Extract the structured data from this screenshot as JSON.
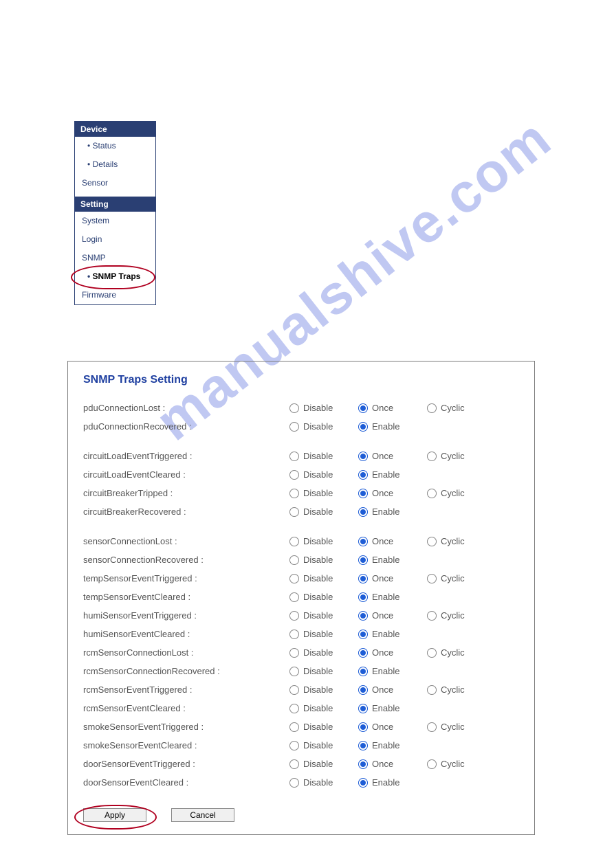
{
  "watermark": "manualshive.com",
  "nav": {
    "sections": [
      {
        "header": "Device",
        "items": [
          {
            "label": "Status",
            "sub": true
          },
          {
            "label": "Details",
            "sub": true
          },
          {
            "label": "Sensor",
            "sub": false
          }
        ]
      },
      {
        "header": "Setting",
        "items": [
          {
            "label": "System",
            "sub": false
          },
          {
            "label": "Login",
            "sub": false
          },
          {
            "label": "SNMP",
            "sub": false
          },
          {
            "label": "SNMP Traps",
            "sub": true,
            "selected": true,
            "circled": true
          },
          {
            "label": "Firmware",
            "sub": false
          }
        ]
      }
    ]
  },
  "panel": {
    "title": "SNMP Traps Setting",
    "option_labels": {
      "disable": "Disable",
      "once": "Once",
      "cyclic": "Cyclic",
      "enable": "Enable"
    },
    "groups": [
      [
        {
          "name": "pduConnectionLost :",
          "type": "tri",
          "selected": "once"
        },
        {
          "name": "pduConnectionRecovered :",
          "type": "bi",
          "selected": "enable"
        }
      ],
      [
        {
          "name": "circuitLoadEventTriggered :",
          "type": "tri",
          "selected": "once"
        },
        {
          "name": "circuitLoadEventCleared :",
          "type": "bi",
          "selected": "enable"
        },
        {
          "name": "circuitBreakerTripped :",
          "type": "tri",
          "selected": "once"
        },
        {
          "name": "circuitBreakerRecovered :",
          "type": "bi",
          "selected": "enable"
        }
      ],
      [
        {
          "name": "sensorConnectionLost :",
          "type": "tri",
          "selected": "once"
        },
        {
          "name": "sensorConnectionRecovered :",
          "type": "bi",
          "selected": "enable"
        },
        {
          "name": "tempSensorEventTriggered :",
          "type": "tri",
          "selected": "once"
        },
        {
          "name": "tempSensorEventCleared :",
          "type": "bi",
          "selected": "enable"
        },
        {
          "name": "humiSensorEventTriggered :",
          "type": "tri",
          "selected": "once"
        },
        {
          "name": "humiSensorEventCleared :",
          "type": "bi",
          "selected": "enable"
        },
        {
          "name": "rcmSensorConnectionLost :",
          "type": "tri",
          "selected": "once"
        },
        {
          "name": "rcmSensorConnectionRecovered :",
          "type": "bi",
          "selected": "enable"
        },
        {
          "name": "rcmSensorEventTriggered :",
          "type": "tri",
          "selected": "once"
        },
        {
          "name": "rcmSensorEventCleared :",
          "type": "bi",
          "selected": "enable"
        },
        {
          "name": "smokeSensorEventTriggered :",
          "type": "tri",
          "selected": "once"
        },
        {
          "name": "smokeSensorEventCleared :",
          "type": "bi",
          "selected": "enable"
        },
        {
          "name": "doorSensorEventTriggered :",
          "type": "tri",
          "selected": "once"
        },
        {
          "name": "doorSensorEventCleared :",
          "type": "bi",
          "selected": "enable"
        }
      ]
    ],
    "buttons": {
      "apply": "Apply",
      "cancel": "Cancel"
    }
  }
}
